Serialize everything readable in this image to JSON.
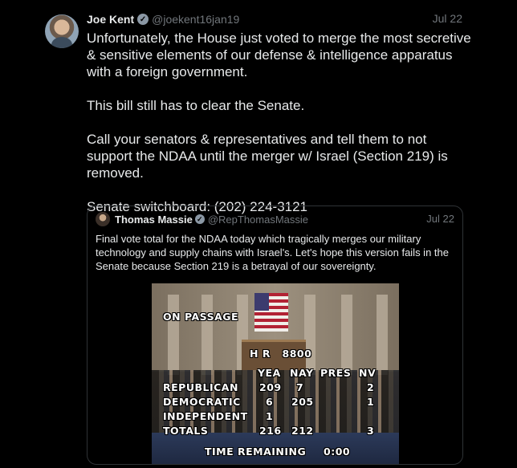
{
  "tweet": {
    "author_name": "Joe Kent",
    "handle": "@joekent16jan19",
    "date": "Jul 22",
    "paragraphs": [
      "Unfortunately, the House just voted to merge the most secretive & sensitive elements of our defense & intelligence apparatus with a foreign government.",
      "This bill still has to clear the Senate.",
      "Call your senators & representatives and tell them to not support the NDAA until the merger w/ Israel (Section 219) is removed.",
      "Senate switchboard: (202) 224-3121"
    ]
  },
  "quote": {
    "author_name": "Thomas Massie",
    "handle": "@RepThomasMassie",
    "date": "Jul 22",
    "text": "Final vote total for the NDAA today which tragically merges our military technology and supply chains with Israel's. Let's hope this version fails in the Senate because Section 219 is a betrayal of our sovereignty."
  },
  "vote_board": {
    "title": "ON PASSAGE",
    "bill": "H R   8800",
    "columns": [
      "YEA",
      "NAY",
      "PRES",
      "NV"
    ],
    "rows": [
      {
        "party": "REPUBLICAN",
        "yea": "209",
        "nay": "7",
        "pres": "",
        "nv": "2"
      },
      {
        "party": "DEMOCRATIC",
        "yea": "6",
        "nay": "205",
        "pres": "",
        "nv": "1"
      },
      {
        "party": "INDEPENDENT",
        "yea": "1",
        "nay": "",
        "pres": "",
        "nv": ""
      },
      {
        "party": "TOTALS",
        "yea": "216",
        "nay": "212",
        "pres": "",
        "nv": "3"
      }
    ],
    "time_label": "TIME REMAINING",
    "time_value": "0:00"
  },
  "icons": {
    "verified": "verified-badge-icon"
  },
  "colors": {
    "background": "#000000",
    "text": "#e7e9ea",
    "muted": "#71767b",
    "border": "#2f3336"
  }
}
